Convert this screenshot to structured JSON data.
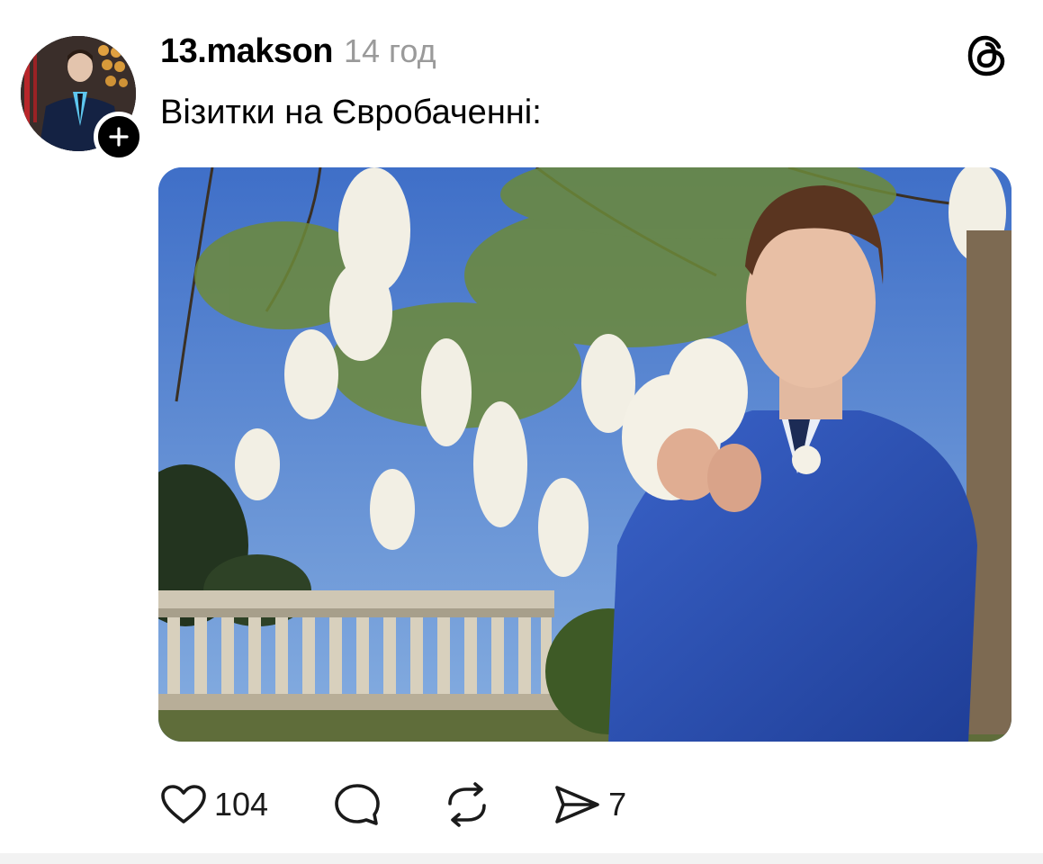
{
  "post": {
    "author": {
      "username": "13.makson",
      "avatar_icon": "avatar-photo",
      "follow_icon": "plus-icon"
    },
    "timestamp": "14 год",
    "text": "Візитки на Євробаченні:",
    "media_description_icon": "photo-man-with-flowers"
  },
  "header": {
    "app_icon": "threads-logo-icon"
  },
  "actions": {
    "like": {
      "icon": "heart-icon",
      "count": "104"
    },
    "reply": {
      "icon": "comment-icon",
      "count": ""
    },
    "repost": {
      "icon": "repost-icon",
      "count": ""
    },
    "share": {
      "icon": "send-icon",
      "count": "7"
    }
  },
  "colors": {
    "text": "#000000",
    "muted": "#9a9a9a",
    "background": "#ffffff",
    "suit_blue": "#2a4fb0",
    "sky": "#4a78c4"
  }
}
